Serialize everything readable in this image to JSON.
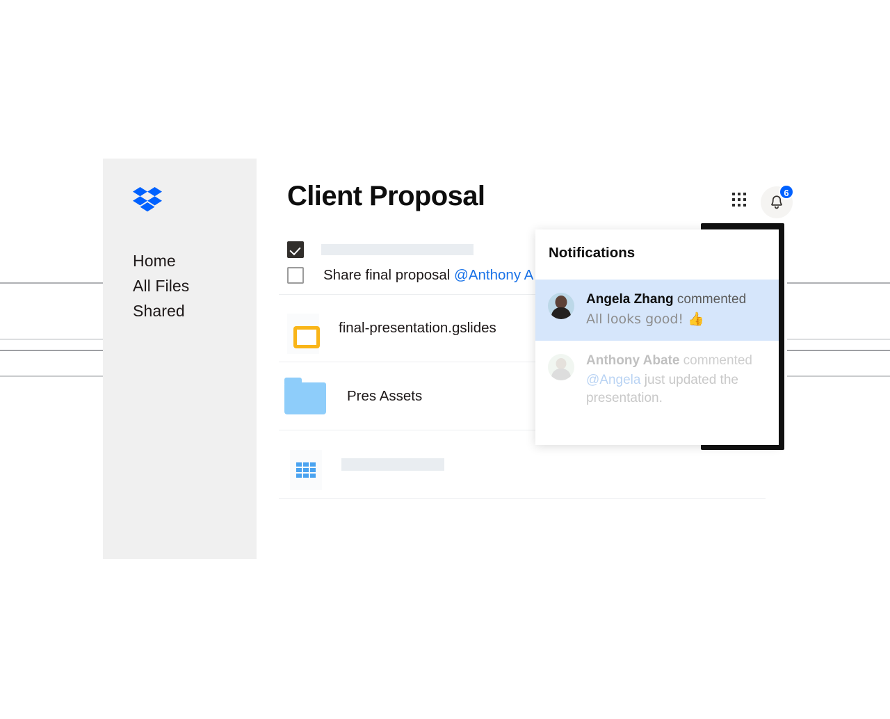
{
  "background": {
    "line_color": "#b9bbbe",
    "accent_blue": "#0061ff",
    "link_blue": "#1a73e8"
  },
  "sidebar": {
    "logo_name": "dropbox-logo",
    "items": [
      {
        "label": "Home"
      },
      {
        "label": "All Files"
      },
      {
        "label": "Shared"
      }
    ]
  },
  "header": {
    "title": "Client Proposal",
    "grid_icon": "grid-apps-icon",
    "bell_icon": "bell-icon",
    "badge_count": "6"
  },
  "tasks": [
    {
      "checked": true,
      "text": "",
      "placeholder": true
    },
    {
      "checked": false,
      "text": "Share final proposal ",
      "mention": "@Anthony A",
      "placeholder": false
    }
  ],
  "files": [
    {
      "icon": "google-slides-icon",
      "name": "final-presentation.gslides",
      "placeholder": false
    },
    {
      "icon": "folder-icon",
      "name": "Pres Assets",
      "placeholder": false
    },
    {
      "icon": "google-sheets-icon",
      "name": "",
      "placeholder": true
    }
  ],
  "notifications": {
    "title": "Notifications",
    "items": [
      {
        "avatar": "avatar-angela-zhang",
        "actor": "Angela Zhang",
        "action": " commented",
        "message": "All looks good! 👍",
        "message_mention": "",
        "message_rest": "",
        "state": "active"
      },
      {
        "avatar": "avatar-anthony-abate",
        "actor": "Anthony Abate",
        "action": " commented",
        "message": "",
        "message_mention": "@Angela",
        "message_rest": " just updated the presentation.",
        "state": "faded"
      }
    ]
  }
}
